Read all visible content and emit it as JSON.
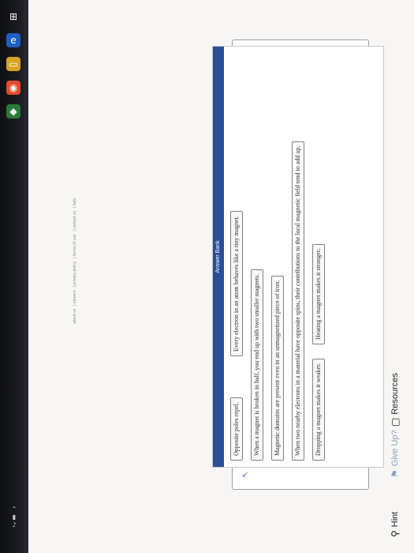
{
  "toolbar": {
    "resources_label": "Resources",
    "give_up_label": "Give Up?",
    "hint_label": "Hint"
  },
  "answer_bank": {
    "title": "Answer Bank",
    "items": [
      "Opposite poles repel.",
      "Every electron in an atom behaves like a tiny magnet.",
      "When a magnet is broken in half, you end up with two smaller magnets.",
      "Magnetic domains are present even in an unmagnetized piece of iron.",
      "When two nearby electrons in a material have opposite spins, their contributions to the local magnetic field tend to add up.",
      "Dropping a magnet makes it weaker.",
      "Heating a magnet makes it stronger."
    ]
  },
  "footer": {
    "links": [
      "about us",
      "careers",
      "privacy policy",
      "terms of use",
      "contact us",
      "help"
    ]
  },
  "colors": {
    "accent": "#2b4f96",
    "link_muted": "#8aa0bd"
  }
}
